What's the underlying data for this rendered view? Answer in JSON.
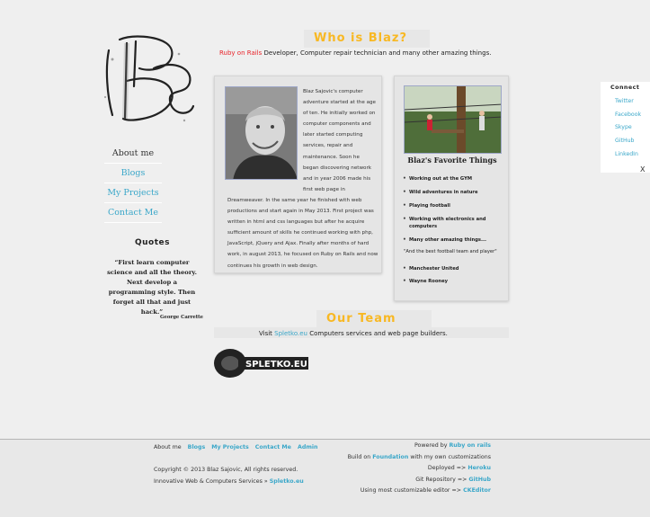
{
  "nav": {
    "items": [
      {
        "label": "About me"
      },
      {
        "label": "Blogs"
      },
      {
        "label": "My Projects"
      },
      {
        "label": "Contact Me"
      }
    ]
  },
  "quotes": {
    "title": "Quotes",
    "text": "“First learn computer science and all the theory. Next develop a programming style. Then forget all that and just hack.”",
    "author": "George Carrette"
  },
  "who": {
    "title": "Who is Blaz?",
    "subtitle_highlight": "Ruby on Rails",
    "subtitle_rest": " Developer, Computer repair technician and many other amazing things."
  },
  "about": {
    "text_top": "Blaz Sajovic's computer adventure started at the age of ten. He initially worked on computer components and later started computing services, repair and maintenance. Soon he began discovering network and in year 2006 made his first web page in",
    "text_bottom": "Dreamweaver. In the same year he finished with web productions and start again in May 2013. First project was written in html and css languages but after he acquire sufficient amount of skills he continued working with php, JavaScript, jQuery and Ajax. Finally after months of hard work, in august 2013, he focused on Ruby on Rails and now continues his growth in web design."
  },
  "favorites": {
    "title": "Blaz's Favorite Things",
    "items": [
      "Working out at the GYM",
      "Wild adventures in nature",
      "Playing football",
      "Working with electronics and computers",
      "Many other amazing things..."
    ],
    "quote": "\"And the best football team and player\"",
    "team_items": [
      "Manchester United",
      "Wayne Rooney"
    ]
  },
  "connect": {
    "title": "Connect",
    "links": [
      "Twitter",
      "Facebook",
      "Skype",
      "GitHub",
      "LinkedIn"
    ],
    "close": "X"
  },
  "team": {
    "title": "Our Team",
    "subtitle_pre": "Visit ",
    "subtitle_link": "Spletko.eu",
    "subtitle_rest": " Computers services and web page builders.",
    "logo_text": "SPLETKO.EU"
  },
  "footer": {
    "nav": {
      "current": "About me",
      "links": [
        "Blogs",
        "My Projects",
        "Contact Me",
        "Admin"
      ]
    },
    "copyright": "Copyright © 2013 Blaz Sajovic, All rights reserved.",
    "services_pre": "Innovative Web & Computers Services » ",
    "services_link": "Spletko.eu",
    "powered_pre": "Powered by ",
    "powered_link": "Ruby on rails",
    "build_pre": "Build on ",
    "build_link": "Foundation",
    "build_rest": " with my own customizations",
    "deployed_pre": "Deployed => ",
    "deployed_link": "Heroku",
    "git_pre": "Git Repository => ",
    "git_link": "GitHub",
    "editor_pre": "Using most customizable editor => ",
    "editor_link": "CKEditor"
  }
}
